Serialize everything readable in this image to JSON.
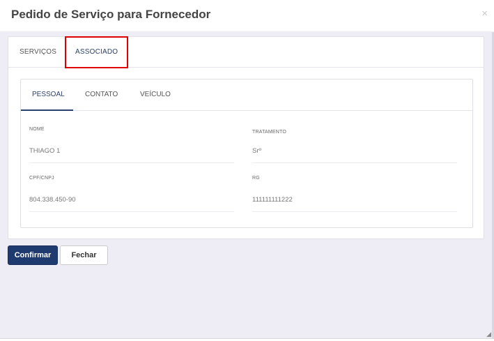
{
  "modal": {
    "title": "Pedido de Serviço para Fornecedor",
    "close_glyph": "×"
  },
  "tabs": [
    {
      "label": "SERVIÇOS"
    },
    {
      "label": "ASSOCIADO"
    }
  ],
  "subtabs": [
    {
      "label": "PESSOAL"
    },
    {
      "label": "CONTATO"
    },
    {
      "label": "VEÍCULO"
    }
  ],
  "fields": {
    "nome": {
      "label": "NOME",
      "value": "THIAGO 1"
    },
    "tratamento": {
      "label": "TRATAMENTO",
      "value": "Srº"
    },
    "cpf_cnpj": {
      "label": "CPF/CNPJ",
      "value": "804.338.450-90"
    },
    "rg": {
      "label": "RG",
      "value": "111111111222"
    }
  },
  "buttons": {
    "confirm": "Confirmar",
    "cancel": "Fechar"
  },
  "colors": {
    "primary": "#1f3a6e",
    "highlight": "#e00000",
    "background": "#eeedf5"
  }
}
